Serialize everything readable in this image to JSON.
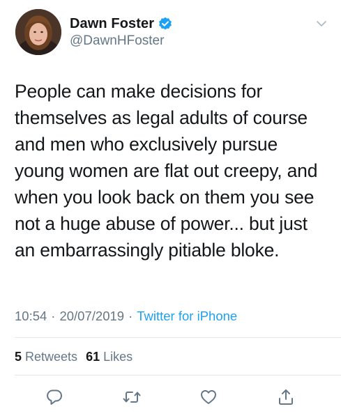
{
  "user": {
    "display_name": "Dawn Foster",
    "handle": "@DawnHFoster",
    "verified": true
  },
  "tweet": {
    "lines": [
      "People can make decisions for",
      "themselves as legal adults of course",
      "and men who exclusively pursue",
      "young women are flat out creepy, and",
      "when you look back on them you see",
      "not a huge abuse of power... but just",
      "an embarrassingly pitiable bloke."
    ]
  },
  "meta": {
    "time": "10:54",
    "separator": "·",
    "date": "20/07/2019",
    "source": "Twitter for iPhone"
  },
  "stats": {
    "retweets_count": "5",
    "retweets_label": "Retweets",
    "likes_count": "61",
    "likes_label": "Likes"
  },
  "icons": {
    "verified": "verified-badge-icon",
    "more": "chevron-down-icon",
    "reply": "reply-icon",
    "retweet": "retweet-icon",
    "like": "heart-icon",
    "share": "share-icon"
  },
  "colors": {
    "accent": "#1da1f2",
    "secondary_text": "#657786",
    "primary_text": "#14171a",
    "divider": "#e1e8ed"
  }
}
